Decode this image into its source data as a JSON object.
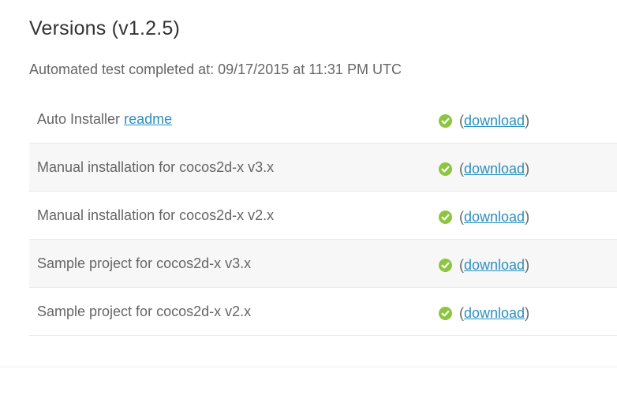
{
  "page": {
    "title": "Versions (v1.2.5)",
    "subtitle": "Automated test completed at: 09/17/2015 at 11:31 PM UTC"
  },
  "rows": [
    {
      "label": "Auto Installer",
      "link": "readme",
      "status": "passed",
      "paren_open": "(",
      "download": "download",
      "paren_close": ")"
    },
    {
      "label": "Manual installation for cocos2d-x v3.x",
      "status": "passed",
      "paren_open": "(",
      "download": "download",
      "paren_close": ")"
    },
    {
      "label": "Manual installation for cocos2d-x v2.x",
      "status": "passed",
      "paren_open": "(",
      "download": "download",
      "paren_close": ")"
    },
    {
      "label": "Sample project for cocos2d-x v3.x",
      "status": "passed",
      "paren_open": "(",
      "download": "download",
      "paren_close": ")"
    },
    {
      "label": "Sample project for cocos2d-x v2.x",
      "status": "passed",
      "paren_open": "(",
      "download": "download",
      "paren_close": ")"
    }
  ],
  "colors": {
    "check_green": "#8cc63f",
    "link_blue": "#2a8fbd"
  },
  "icons": {
    "status": "check-circle-icon"
  }
}
